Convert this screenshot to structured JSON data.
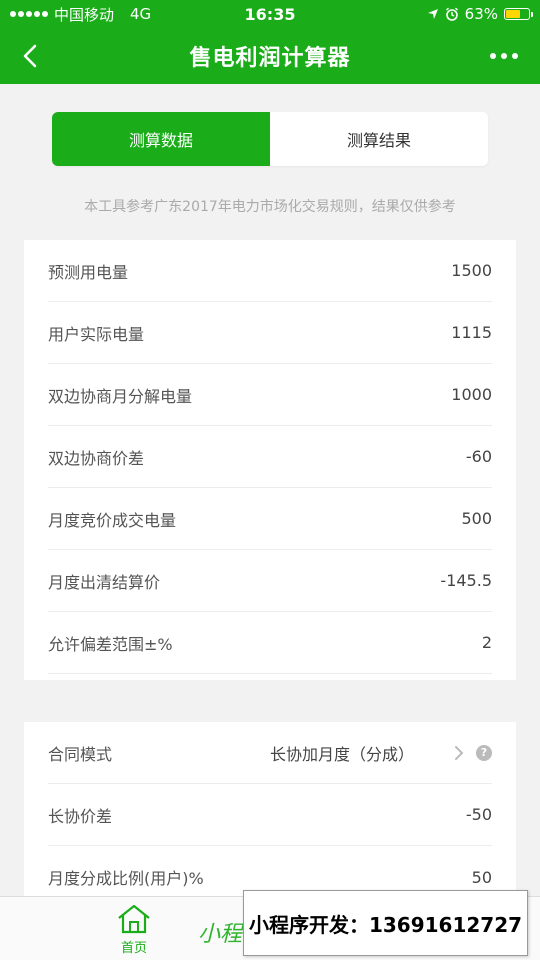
{
  "status_bar": {
    "carrier": "中国移动",
    "network": "4G",
    "time": "16:35",
    "battery": "63%",
    "battery_level": 0.63
  },
  "nav": {
    "title": "售电利润计算器"
  },
  "tabs": [
    {
      "label": "测算数据",
      "active": true
    },
    {
      "label": "测算结果",
      "active": false
    }
  ],
  "notice": "本工具参考广东2017年电力市场化交易规则，结果仅供参考",
  "form1": [
    {
      "label": "预测用电量",
      "value": "1500"
    },
    {
      "label": "用户实际电量",
      "value": "1115"
    },
    {
      "label": "双边协商月分解电量",
      "value": "1000"
    },
    {
      "label": "双边协商价差",
      "value": "-60"
    },
    {
      "label": "月度竞价成交电量",
      "value": "500"
    },
    {
      "label": "月度出清结算价",
      "value": "-145.5"
    },
    {
      "label": "允许偏差范围±%",
      "value": "2"
    }
  ],
  "form2": [
    {
      "label": "合同模式",
      "value": "长协加月度（分成）"
    },
    {
      "label": "长协价差",
      "value": "-50"
    },
    {
      "label": "月度分成比例(用户)%",
      "value": "50"
    }
  ],
  "tabbar": {
    "home_label": "首页"
  },
  "watermark": "小程",
  "promo": "小程序开发：13691612727",
  "colors": {
    "brand": "#1aad19",
    "background": "#f2f2f2"
  }
}
